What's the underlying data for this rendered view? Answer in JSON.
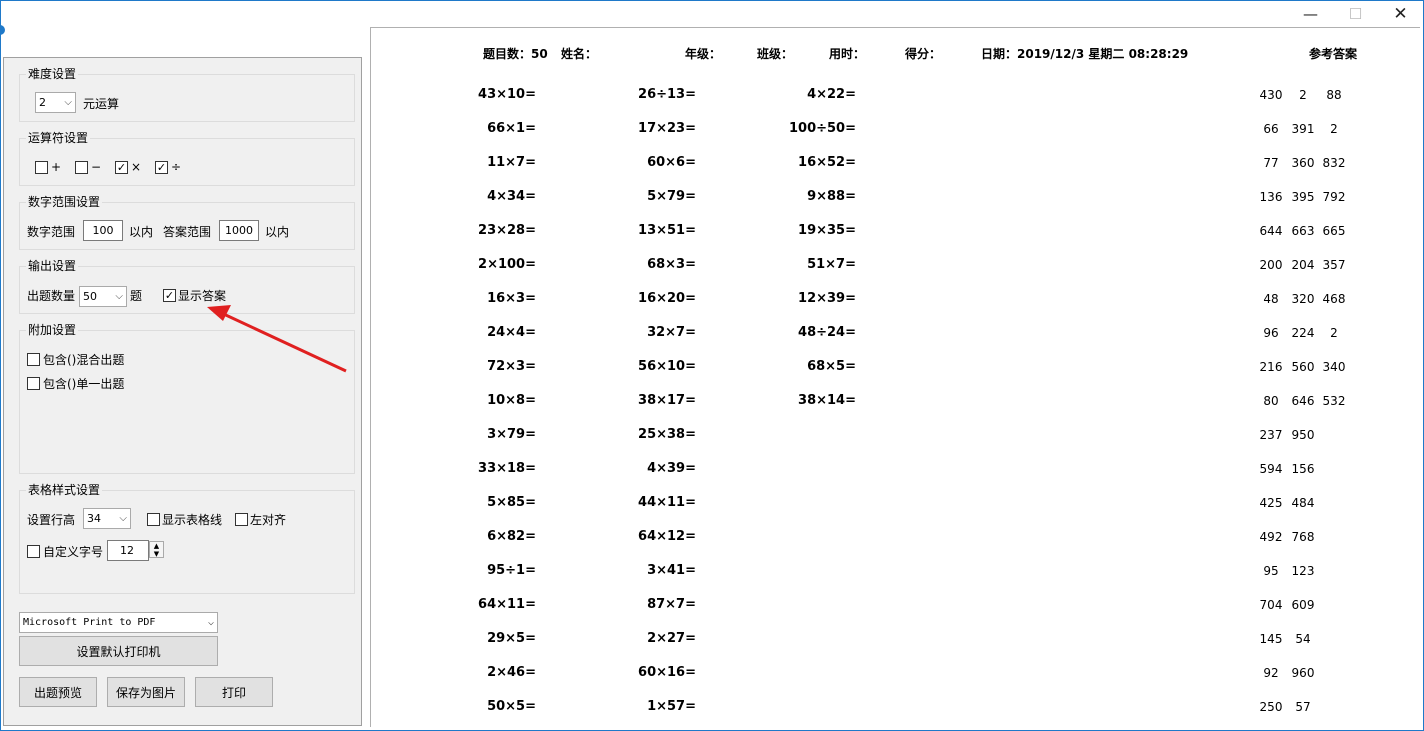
{
  "window": {
    "minimize": "—",
    "maximize": "☐",
    "close": "✕"
  },
  "difficulty": {
    "title": "难度设置",
    "value": "2",
    "suffix": "元运算"
  },
  "operators": {
    "title": "运算符设置",
    "items": [
      {
        "symbol": "+",
        "checked": false
      },
      {
        "symbol": "−",
        "checked": false
      },
      {
        "symbol": "×",
        "checked": true
      },
      {
        "symbol": "÷",
        "checked": true
      }
    ]
  },
  "range": {
    "title": "数字范围设置",
    "num_label": "数字范围",
    "num_value": "100",
    "num_suffix": "以内",
    "ans_label": "答案范围",
    "ans_value": "1000",
    "ans_suffix": "以内"
  },
  "output": {
    "title": "输出设置",
    "count_label": "出题数量",
    "count_value": "50",
    "count_suffix": "题",
    "show_answer_label": "显示答案",
    "show_answer_checked": true
  },
  "extra": {
    "title": "附加设置",
    "mixed_label": "包含()混合出题",
    "single_label": "包含()单一出题"
  },
  "table_style": {
    "title": "表格样式设置",
    "row_height_label": "设置行高",
    "row_height_value": "34",
    "grid_label": "显示表格线",
    "left_align_label": "左对齐",
    "font_label": "自定义字号",
    "font_value": "12"
  },
  "printer": {
    "name": "Microsoft Print to PDF",
    "set_default": "设置默认打印机"
  },
  "buttons": {
    "preview": "出题预览",
    "save_image": "保存为图片",
    "print": "打印"
  },
  "sheet": {
    "count": "题目数：50",
    "name": "姓名：",
    "grade": "年级：",
    "class": "班级：",
    "time": "用时：",
    "score": "得分：",
    "date": "日期：2019/12/3 星期二 08:28:29",
    "answers_title": "参考答案",
    "col1": [
      "43×10=",
      "66×1=",
      "11×7=",
      "4×34=",
      "23×28=",
      "2×100=",
      "16×3=",
      "24×4=",
      "72×3=",
      "10×8=",
      "3×79=",
      "33×18=",
      "5×85=",
      "6×82=",
      "95÷1=",
      "64×11=",
      "29×5=",
      "2×46=",
      "50×5="
    ],
    "col2": [
      "26÷13=",
      "17×23=",
      "60×6=",
      "5×79=",
      "13×51=",
      "68×3=",
      "16×20=",
      "32×7=",
      "56×10=",
      "38×17=",
      "25×38=",
      "4×39=",
      "44×11=",
      "64×12=",
      "3×41=",
      "87×7=",
      "2×27=",
      "60×16=",
      "1×57="
    ],
    "col3": [
      "4×22=",
      "100÷50=",
      "16×52=",
      "9×88=",
      "19×35=",
      "51×7=",
      "12×39=",
      "48÷24=",
      "68×5=",
      "38×14="
    ],
    "answers": [
      [
        "430",
        "2",
        "88"
      ],
      [
        "66",
        "391",
        "2"
      ],
      [
        "77",
        "360",
        "832"
      ],
      [
        "136",
        "395",
        "792"
      ],
      [
        "644",
        "663",
        "665"
      ],
      [
        "200",
        "204",
        "357"
      ],
      [
        "48",
        "320",
        "468"
      ],
      [
        "96",
        "224",
        "2"
      ],
      [
        "216",
        "560",
        "340"
      ],
      [
        "80",
        "646",
        "532"
      ],
      [
        "237",
        "950",
        ""
      ],
      [
        "594",
        "156",
        ""
      ],
      [
        "425",
        "484",
        ""
      ],
      [
        "492",
        "768",
        ""
      ],
      [
        "95",
        "123",
        ""
      ],
      [
        "704",
        "609",
        ""
      ],
      [
        "145",
        "54",
        ""
      ],
      [
        "92",
        "960",
        ""
      ],
      [
        "250",
        "57",
        ""
      ]
    ]
  }
}
